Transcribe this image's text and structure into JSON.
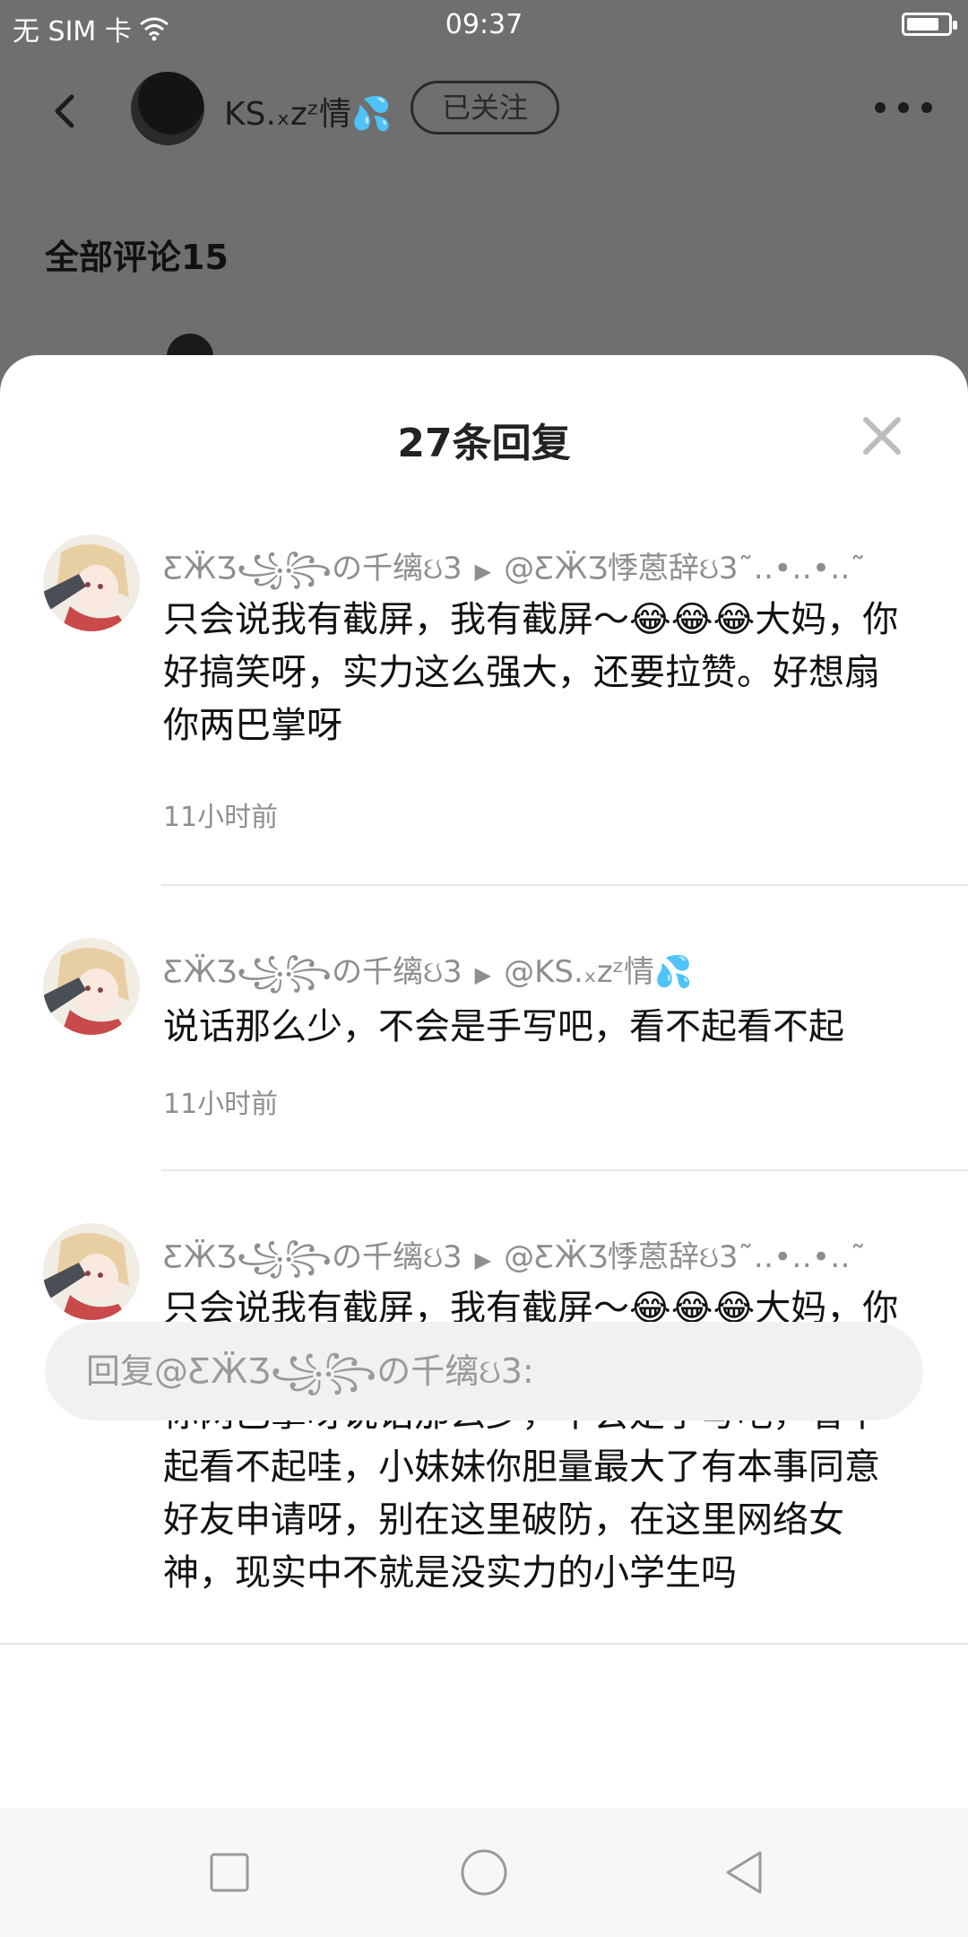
{
  "status_bar": {
    "carrier": "无 SIM 卡",
    "time": "09:37"
  },
  "header": {
    "username": "KS.ₓᴢᶻ情💦",
    "follow_label": "已关注",
    "section_title": "全部评论15"
  },
  "sheet": {
    "title": "27条回复"
  },
  "replies": [
    {
      "author": "ƸӜƷ꧁꧂の千缡ઇ3",
      "target": "@ƸӜƷ悸蒽辞ઇ3˜‥•‥•‥˜",
      "body": "只会说我有截屏，我有截屏〜😂😂😂大妈，你好搞笑呀，实力这么强大，还要拉赞。好想扇你两巴掌呀",
      "time": "11小时前"
    },
    {
      "author": "ƸӜƷ꧁꧂の千缡ઇ3",
      "target": "@KS.ₓᴢᶻ情💦",
      "body": "说话那么少，不会是手写吧，看不起看不起",
      "time": "11小时前"
    },
    {
      "author": "ƸӜƷ꧁꧂の千缡ઇ3",
      "target": "@ƸӜƷ悸蒽辞ઇ3˜‥•‥•‥˜",
      "body": "只会说我有截屏，我有截屏〜😂😂😂大妈，你好搞笑呀，实力这么强大，还要拉赞。好想扇你两巴掌呀说话那么少，不会是手写吧，看不起看不起哇，小妹妹你胆量最大了有本事同意好友申请呀，别在这里破防，在这里网络女神，现实中不就是没实力的小学生吗"
    }
  ],
  "reply_input": {
    "placeholder": "回复@ƸӜƷ꧁꧂の千缡ઇ3:"
  },
  "icons": {
    "back": "chevron-left-icon",
    "more": "ellipsis-icon",
    "close": "close-icon",
    "wifi": "wifi-icon",
    "battery": "battery-icon",
    "nav_square": "recent-apps-icon",
    "nav_circle": "home-icon",
    "nav_triangle": "back-triangle-icon"
  }
}
